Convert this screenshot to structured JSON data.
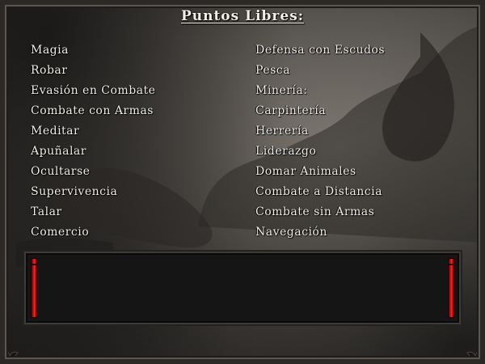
{
  "title": "Puntos Libres:",
  "skills_left": [
    "Magia",
    "Robar",
    "Evasión en Combate",
    "Combate con Armas",
    "Meditar",
    "Apuñalar",
    "Ocultarse",
    "Supervivencia",
    "Talar",
    "Comercio"
  ],
  "skills_right": [
    "Defensa con Escudos",
    "Pesca",
    "Minería:",
    "Carpintería",
    "Herrería",
    "Liderazgo",
    "Domar Animales",
    "Combate a Distancia",
    "Combate sin Armas",
    "Navegación"
  ],
  "console": {
    "text": ""
  },
  "colors": {
    "text": "#f3f0ea",
    "accent_red": "#e01010",
    "panel": "#161515"
  }
}
